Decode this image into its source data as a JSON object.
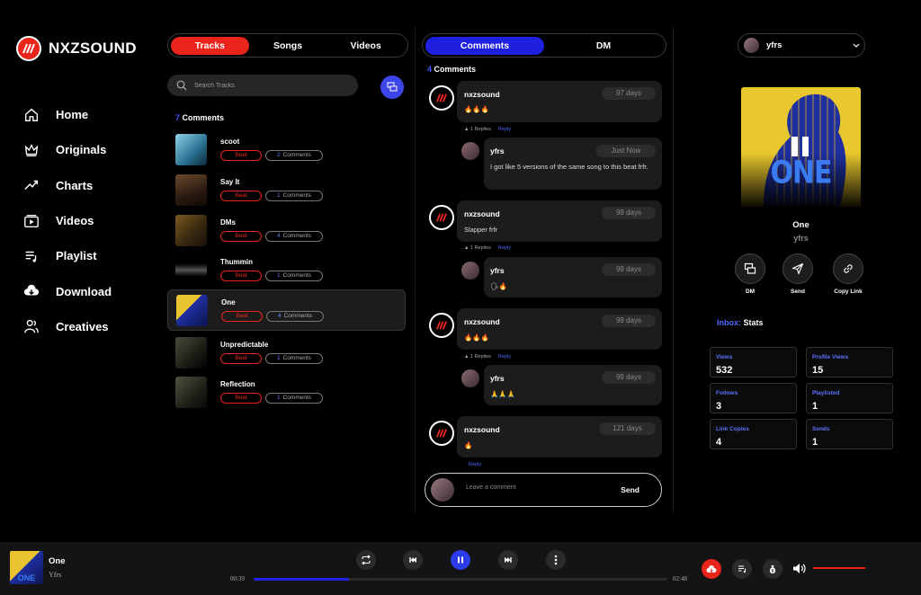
{
  "brand": {
    "name": "NXZSOUND"
  },
  "nav": [
    {
      "label": "Home",
      "icon": "home-icon"
    },
    {
      "label": "Originals",
      "icon": "crown-icon"
    },
    {
      "label": "Charts",
      "icon": "trend-icon"
    },
    {
      "label": "Videos",
      "icon": "video-icon"
    },
    {
      "label": "Playlist",
      "icon": "playlist-icon"
    },
    {
      "label": "Download",
      "icon": "cloud-download-icon"
    },
    {
      "label": "Creatives",
      "icon": "users-icon"
    }
  ],
  "left_tabs": [
    "Tracks",
    "Songs",
    "Videos"
  ],
  "search": {
    "placeholder": "Search Tracks"
  },
  "tracks_header": {
    "count": "7",
    "label": "Comments"
  },
  "tracks": [
    {
      "name": "scoot",
      "tag": "Beat",
      "comments": "2",
      "comments_label": "Comments"
    },
    {
      "name": "Say It",
      "tag": "Beat",
      "comments": "1",
      "comments_label": "Comments"
    },
    {
      "name": "DMs",
      "tag": "Beat",
      "comments": "4",
      "comments_label": "Comments"
    },
    {
      "name": "Thummin",
      "tag": "Beat",
      "comments": "1",
      "comments_label": "Comments"
    },
    {
      "name": "One",
      "tag": "Beat",
      "comments": "4",
      "comments_label": "Comments"
    },
    {
      "name": "Unpredictable",
      "tag": "Beat",
      "comments": "1",
      "comments_label": "Comments"
    },
    {
      "name": "Reflection",
      "tag": "Beat",
      "comments": "1",
      "comments_label": "Comments"
    }
  ],
  "mid_tabs": [
    "Comments",
    "DM"
  ],
  "comments_header": {
    "count": "4",
    "label": "Comments"
  },
  "comments": [
    {
      "user": "nxzsound",
      "date": "97 days",
      "text": "🔥🔥🔥",
      "replies": "1 Replies",
      "reply": "Reply",
      "child": {
        "user": "yfrs",
        "date": "Just Now",
        "text": "I got like 5 versions of the same song to this beat frfr."
      }
    },
    {
      "user": "nxzsound",
      "date": "99 days",
      "text": "Slapper frfr",
      "replies": "1 Replies",
      "reply": "Reply",
      "child": {
        "user": "yfrs",
        "date": "99 days",
        "text": "🗣🔥"
      }
    },
    {
      "user": "nxzsound",
      "date": "99 days",
      "text": "🔥🔥🔥",
      "replies": "1 Replies",
      "reply": "Reply",
      "child": {
        "user": "yfrs",
        "date": "99 days",
        "text": "🙏🙏🙏"
      }
    },
    {
      "user": "nxzsound",
      "date": "121 days",
      "text": "🔥",
      "reply": "Reply"
    }
  ],
  "comment_input": {
    "placeholder": "Leave a comment",
    "send": "Send"
  },
  "user_select": {
    "name": "yfrs"
  },
  "now": {
    "title": "One",
    "artist": "yfrs",
    "cover_text": "ONE"
  },
  "actions": [
    {
      "label": "DM"
    },
    {
      "label": "Send"
    },
    {
      "label": "Copy Link"
    }
  ],
  "inbox": {
    "prefix": "Inbox:",
    "label": "Stats"
  },
  "stats": [
    {
      "key": "Views",
      "value": "532"
    },
    {
      "key": "Profile Views",
      "value": "15"
    },
    {
      "key": "Follows",
      "value": "3"
    },
    {
      "key": "Playlisted",
      "value": "1"
    },
    {
      "key": "Link Copies",
      "value": "4"
    },
    {
      "key": "Sends",
      "value": "1"
    }
  ],
  "player": {
    "title": "One",
    "artist": "Yfrs",
    "elapsed": "00:39",
    "duration": "02:48",
    "progress_fraction": 0.23,
    "volume_fraction": 1.0
  },
  "colors": {
    "accent_red": "#e8241b",
    "accent_blue": "#1f1fe0",
    "link_blue": "#4d69ff"
  }
}
